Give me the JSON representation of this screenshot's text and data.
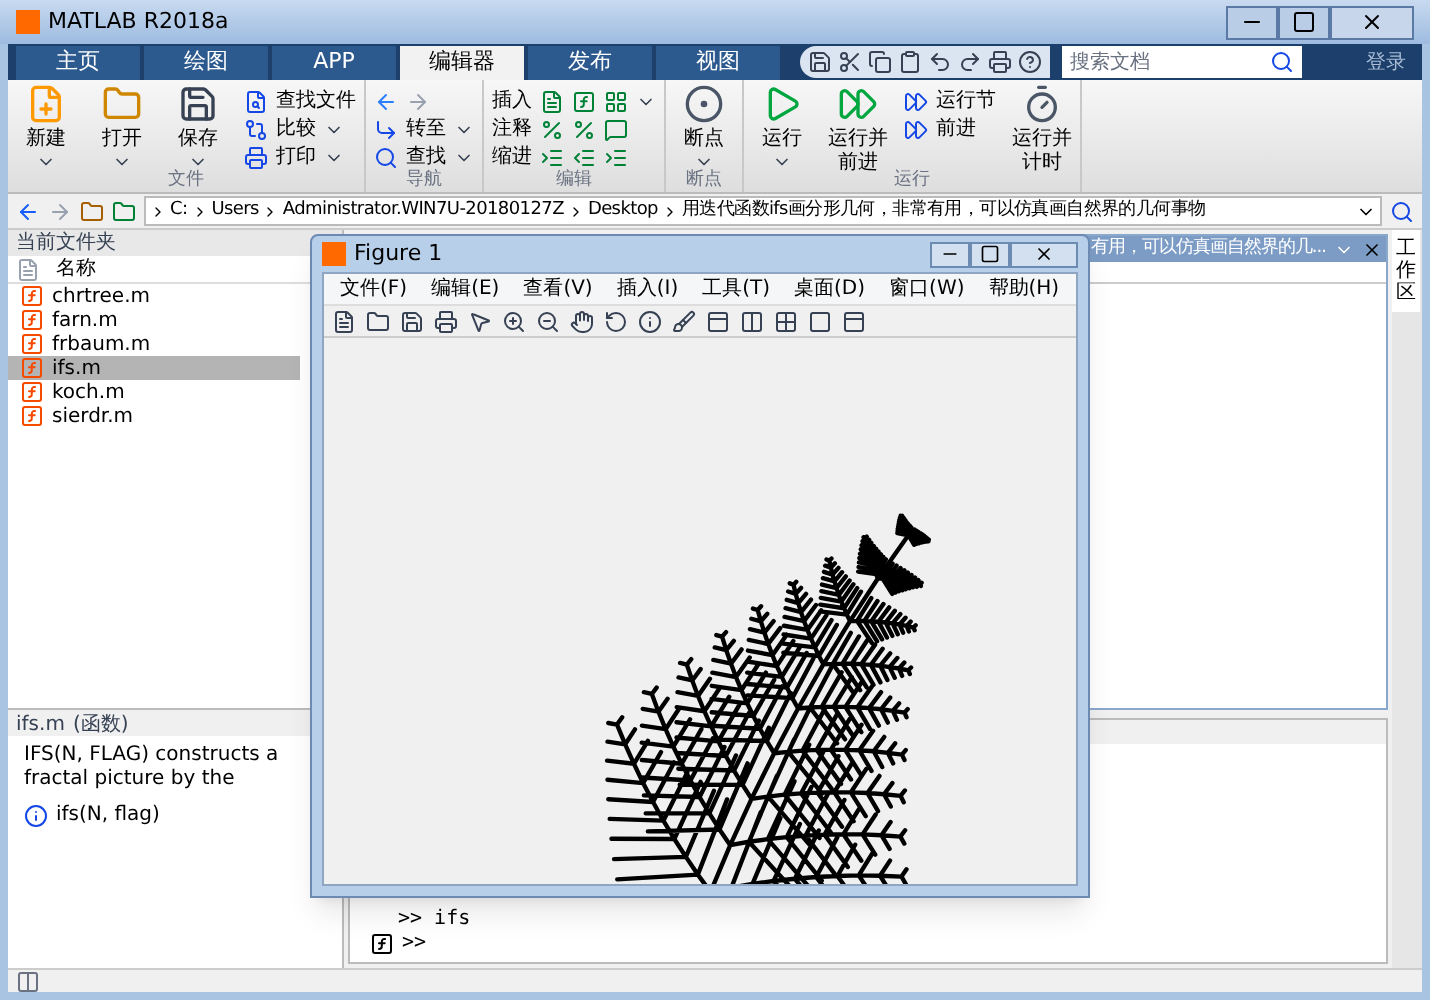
{
  "window": {
    "title": "MATLAB R2018a"
  },
  "tabs": [
    {
      "label": "主页",
      "selected": false
    },
    {
      "label": "绘图",
      "selected": false
    },
    {
      "label": "APP",
      "selected": false
    },
    {
      "label": "编辑器",
      "selected": true
    },
    {
      "label": "发布",
      "selected": false
    },
    {
      "label": "视图",
      "selected": false
    }
  ],
  "search": {
    "placeholder": "搜索文档"
  },
  "sign_in": "登录",
  "ribbon": [
    {
      "label": "文件",
      "items": [
        {
          "kind": "large",
          "label": "新建",
          "dropdown": true
        },
        {
          "kind": "large",
          "label": "打开",
          "dropdown": true
        },
        {
          "kind": "large",
          "label": "保存",
          "dropdown": true
        },
        {
          "kind": "small",
          "label": "查找文件",
          "dropdown": false
        },
        {
          "kind": "small",
          "label": "比较",
          "dropdown": true
        },
        {
          "kind": "small",
          "label": "打印",
          "dropdown": true
        }
      ]
    },
    {
      "label": "导航",
      "items": [
        {
          "kind": "arrows"
        },
        {
          "kind": "small",
          "label": "转至",
          "dropdown": true
        },
        {
          "kind": "small",
          "label": "查找",
          "dropdown": true
        }
      ]
    },
    {
      "label": "编辑",
      "items": [
        {
          "kind": "row",
          "label": "插入",
          "dropdown": true
        },
        {
          "kind": "row",
          "label": "注释",
          "dropdown": false
        },
        {
          "kind": "row",
          "label": "缩进",
          "dropdown": false
        }
      ]
    },
    {
      "label": "断点",
      "items": [
        {
          "kind": "large",
          "label": "断点",
          "dropdown": true
        }
      ]
    },
    {
      "label": "运行",
      "items": [
        {
          "kind": "large",
          "label": "运行",
          "dropdown": true
        },
        {
          "kind": "large",
          "label": "运行并前进",
          "dropdown": false
        },
        {
          "kind": "small",
          "label": "运行节",
          "dropdown": false
        },
        {
          "kind": "small",
          "label": "前进",
          "dropdown": false
        },
        {
          "kind": "large",
          "label": "运行并计时",
          "dropdown": false
        }
      ]
    }
  ],
  "path": [
    "C:",
    "Users",
    "Administrator.WIN7U-20180127Z",
    "Desktop",
    "用迭代函数ifs画分形几何，非常有用，可以仿真画自然界的几何事物"
  ],
  "current_folder": {
    "title": "当前文件夹",
    "column": "名称",
    "files": [
      {
        "name": "chrtree.m",
        "selected": false
      },
      {
        "name": "farn.m",
        "selected": false
      },
      {
        "name": "frbaum.m",
        "selected": false
      },
      {
        "name": "ifs.m",
        "selected": true
      },
      {
        "name": "koch.m",
        "selected": false
      },
      {
        "name": "sierdr.m",
        "selected": false
      }
    ]
  },
  "details": {
    "title": "ifs.m",
    "type": "(函数)",
    "description": "IFS(N, FLAG) constructs a fractal picture by the",
    "signature": "ifs(N, flag)"
  },
  "editor": {
    "title": "有用，可以仿真画自然界的几..."
  },
  "workspace_tab": "工作区",
  "command_window": {
    "lines": [
      ">> ifs"
    ],
    "prompt": ">>"
  },
  "figure": {
    "title": "Figure 1",
    "menu": [
      "文件(F)",
      "编辑(E)",
      "查看(V)",
      "插入(I)",
      "工具(T)",
      "桌面(D)",
      "窗口(W)",
      "帮助(H)"
    ]
  }
}
